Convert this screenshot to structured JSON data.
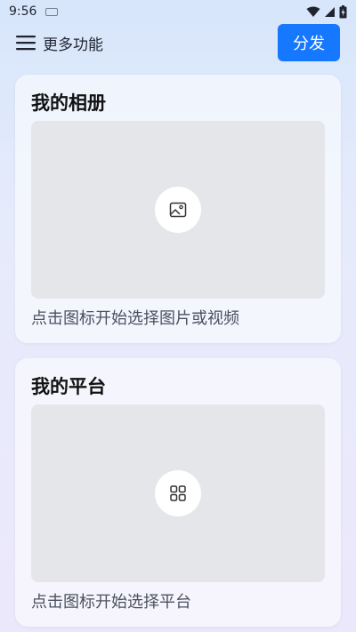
{
  "status_bar": {
    "time": "9:56"
  },
  "header": {
    "menu_label": "更多功能",
    "share_label": "分发"
  },
  "album_card": {
    "title": "我的相册",
    "hint": "点击图标开始选择图片或视频",
    "icon": "image-icon"
  },
  "platform_card": {
    "title": "我的平台",
    "hint": "点击图标开始选择平台",
    "icon": "grid-icon"
  },
  "colors": {
    "accent": "#1677ff",
    "placeholder_bg": "#e4e6ea"
  }
}
